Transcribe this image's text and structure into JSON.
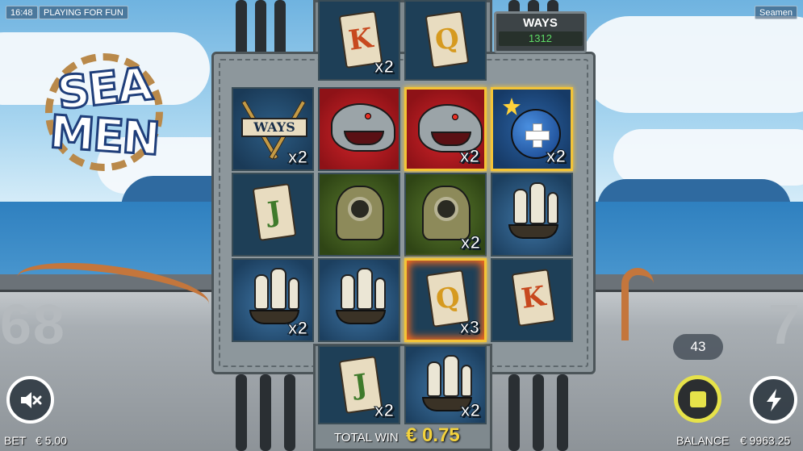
{
  "status_bar": {
    "time": "16:48",
    "mode": "PLAYING FOR FUN",
    "game_name": "Seamen"
  },
  "logo": {
    "line1": "SEA",
    "line2": "MEN"
  },
  "ways": {
    "label": "WAYS",
    "value": "1312"
  },
  "reels": [
    {
      "cells": [
        {
          "symbol": "ways",
          "label": "WAYS",
          "multiplier": "x2",
          "win": false
        },
        {
          "symbol": "card",
          "label": "J",
          "multiplier": "",
          "win": false
        },
        {
          "symbol": "ship",
          "label": "",
          "multiplier": "x2",
          "win": false
        }
      ]
    },
    {
      "cells": [
        {
          "symbol": "card",
          "label": "K",
          "multiplier": "x2",
          "win": false
        },
        {
          "symbol": "shark",
          "label": "",
          "multiplier": "",
          "win": false
        },
        {
          "symbol": "helmet",
          "label": "",
          "multiplier": "",
          "win": false
        },
        {
          "symbol": "ship",
          "label": "",
          "multiplier": "",
          "win": false
        },
        {
          "symbol": "card",
          "label": "J",
          "multiplier": "x2",
          "win": false
        }
      ]
    },
    {
      "cells": [
        {
          "symbol": "card",
          "label": "Q",
          "multiplier": "",
          "win": false
        },
        {
          "symbol": "shark",
          "label": "",
          "multiplier": "x2",
          "win": true
        },
        {
          "symbol": "helmet",
          "label": "",
          "multiplier": "x2",
          "win": false
        },
        {
          "symbol": "card",
          "label": "Q",
          "multiplier": "x3",
          "win": true
        },
        {
          "symbol": "ship",
          "label": "",
          "multiplier": "x2",
          "win": false
        }
      ]
    },
    {
      "cells": [
        {
          "symbol": "bomb",
          "label": "",
          "multiplier": "x2",
          "win": true
        },
        {
          "symbol": "ship",
          "label": "",
          "multiplier": "",
          "win": false
        },
        {
          "symbol": "card",
          "label": "K",
          "multiplier": "",
          "win": false
        }
      ]
    }
  ],
  "bottom_bar": {
    "bet_label": "BET",
    "bet_value": "€ 5.00",
    "total_win_label": "TOTAL WIN",
    "total_win_value": "€ 0.75",
    "balance_label": "BALANCE",
    "balance_value": "€ 9963.25"
  },
  "autospin_counter": "43",
  "controls": {
    "mute": "sound-off-icon",
    "spin": "stop-icon",
    "turbo": "lightning-icon"
  },
  "colors": {
    "win_frame": "#f3c437",
    "total_win": "#f3d23d",
    "spin_ring": "#e6e24a",
    "ways_display": "#5fdc66"
  }
}
